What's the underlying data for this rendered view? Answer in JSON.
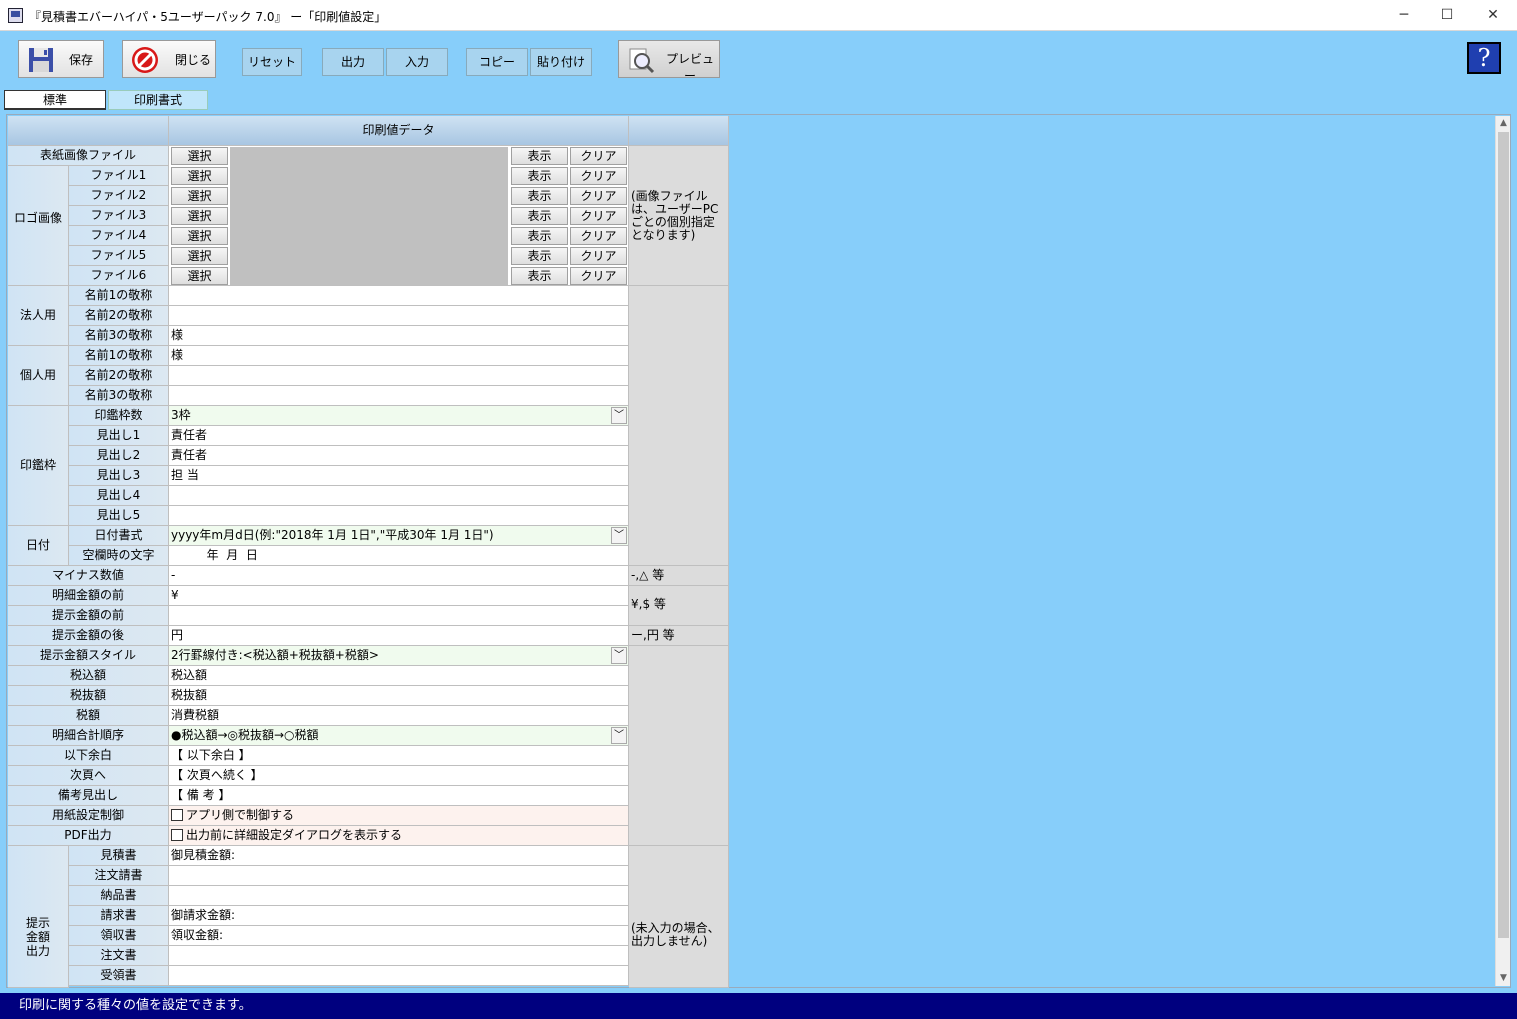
{
  "window": {
    "title": "『見積書エバーハイパ・5ユーザーパック 7.0』 ー「印刷値設定」",
    "min": "─",
    "max": "☐",
    "close": "✕"
  },
  "toolbar": {
    "save": "保存",
    "close": "閉じる",
    "reset": "リセット",
    "output": "出力",
    "input": "入力",
    "copy": "コピー",
    "paste": "貼り付け",
    "preview": "プレビュー",
    "help": "?"
  },
  "tabs": {
    "standard": "標準",
    "print_format": "印刷書式"
  },
  "grid": {
    "header": "印刷値データ",
    "cover": "表紙画像ファイル",
    "logo": "ロゴ画像",
    "files": [
      "ファイル1",
      "ファイル2",
      "ファイル3",
      "ファイル4",
      "ファイル5",
      "ファイル6"
    ],
    "select": "選択",
    "show": "表示",
    "clear": "クリア",
    "image_note": "(画像ファイルは、ユーザーPCごとの個別指定となります)",
    "corp": "法人用",
    "indiv": "個人用",
    "hon1": "名前1の敬称",
    "hon2": "名前2の敬称",
    "hon3": "名前3の敬称",
    "corp_vals": [
      "",
      "",
      "様"
    ],
    "indiv_vals": [
      "様",
      "",
      ""
    ],
    "seal": "印鑑枠",
    "seal_count": "印鑑枠数",
    "seal_count_val": "3枠",
    "heads": [
      "見出し1",
      "見出し2",
      "見出し3",
      "見出し4",
      "見出し5"
    ],
    "head_vals": [
      "責任者",
      "責任者",
      "担 当",
      "",
      ""
    ],
    "date": "日付",
    "date_fmt": "日付書式",
    "date_fmt_val": "yyyy年m月d日(例:\"2018年 1月 1日\",\"平成30年 1月 1日\")",
    "blank_date": "空欄時の文字",
    "blank_date_val": "  年  月  日",
    "minus": "マイナス数値",
    "minus_val": "-",
    "minus_note": "-,△ 等",
    "detail_before": "明細金額の前",
    "detail_before_val": "¥",
    "show_before": "提示金額の前",
    "show_before_val": "",
    "before_note": "¥,$ 等",
    "show_after": "提示金額の後",
    "show_after_val": "円",
    "after_note": "ー,円 等",
    "style": "提示金額スタイル",
    "style_val": "2行罫線付き:<税込額+税抜額+税額>",
    "taxin": "税込額",
    "taxin_val": "税込額",
    "taxout": "税抜額",
    "taxout_val": "税抜額",
    "tax": "税額",
    "tax_val": "消費税額",
    "order": "明細合計順序",
    "order_val": "●税込額→◎税抜額→○税額",
    "below": "以下余白",
    "below_val": "【 以下余白 】",
    "next": "次頁へ",
    "next_val": "【 次頁へ続く 】",
    "remarks": "備考見出し",
    "remarks_val": "【 備 考 】",
    "paper": "用紙設定制御",
    "paper_val": "アプリ側で制御する",
    "pdf": "PDF出力",
    "pdf_val": "出力前に詳細設定ダイアログを表示する",
    "amount_out": "提示金額出力",
    "docs": [
      "見積書",
      "注文請書",
      "納品書",
      "請求書",
      "領収書",
      "注文書",
      "受領書"
    ],
    "doc_vals": [
      "御見積金額:",
      "",
      "",
      "御請求金額:",
      "領収金額:",
      "",
      ""
    ],
    "doc_note": "(未入力の場合、出力しません)"
  },
  "status": "印刷に関する種々の値を設定できます。"
}
